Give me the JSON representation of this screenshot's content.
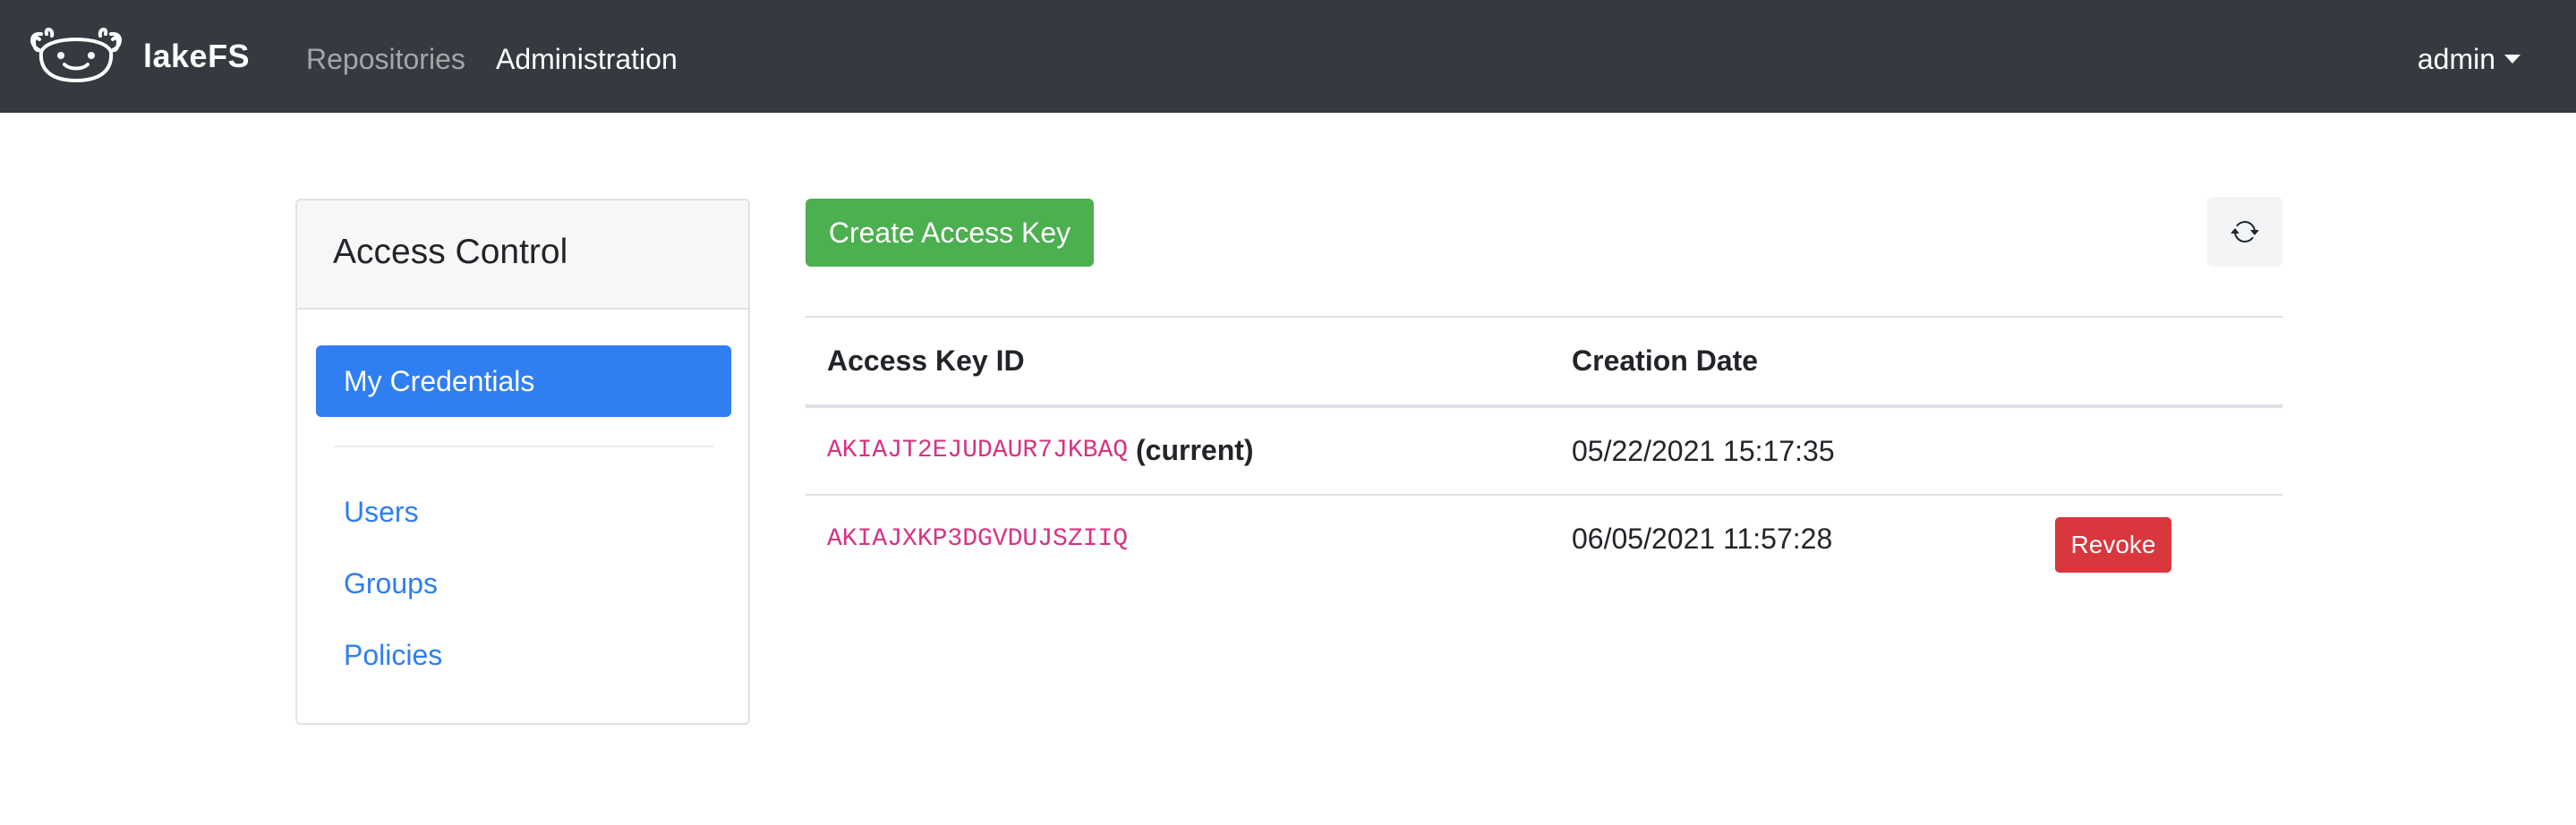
{
  "navbar": {
    "brand": "lakeFS",
    "links": [
      {
        "label": "Repositories",
        "active": false
      },
      {
        "label": "Administration",
        "active": true
      }
    ],
    "user": "admin",
    "background": "#343a40"
  },
  "sidebar": {
    "title": "Access Control",
    "active_item": "My Credentials",
    "items": [
      {
        "label": "Users"
      },
      {
        "label": "Groups"
      },
      {
        "label": "Policies"
      }
    ],
    "accent": "#2f7ef2"
  },
  "main": {
    "create_button": "Create Access Key",
    "refresh_icon": "refresh-icon",
    "table": {
      "columns": [
        "Access Key ID",
        "Creation Date"
      ],
      "rows": [
        {
          "key_id": "AKIAJT2EJUDAUR7JKBAQ",
          "tag": "(current)",
          "created": "05/22/2021 15:17:35",
          "action": ""
        },
        {
          "key_id": "AKIAJXKP3DGVDUJSZIIQ",
          "tag": "",
          "created": "06/05/2021 11:57:28",
          "action": "Revoke"
        }
      ]
    }
  },
  "colors": {
    "create_button": "#4caf50",
    "revoke_button": "#d9363e",
    "key_id_text": "#d63384"
  }
}
